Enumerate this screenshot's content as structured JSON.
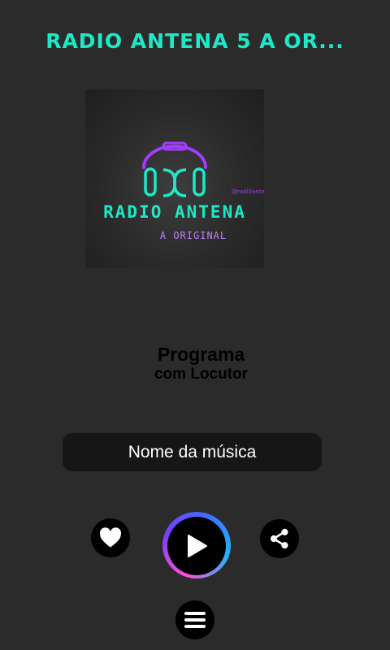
{
  "app": {
    "title": "RADIO ANTENA 5 A OR..."
  },
  "artwork": {
    "name_text": "RADIO ANTENA",
    "tagline": "A ORIGINAL",
    "handle": "@radi0ante",
    "colors": {
      "neon_cyan": "#1de9c6",
      "neon_purple": "#a33cff"
    }
  },
  "program": {
    "line1": "Programa",
    "line2": "com Locutor"
  },
  "now_playing": {
    "song": "Nome da música"
  },
  "controls": {
    "like_icon": "heart-icon",
    "play_icon": "play-icon",
    "share_icon": "share-icon",
    "menu_icon": "hamburger-menu-icon"
  },
  "colors": {
    "accent": "#1de9c6",
    "background": "#2b2b2b"
  }
}
